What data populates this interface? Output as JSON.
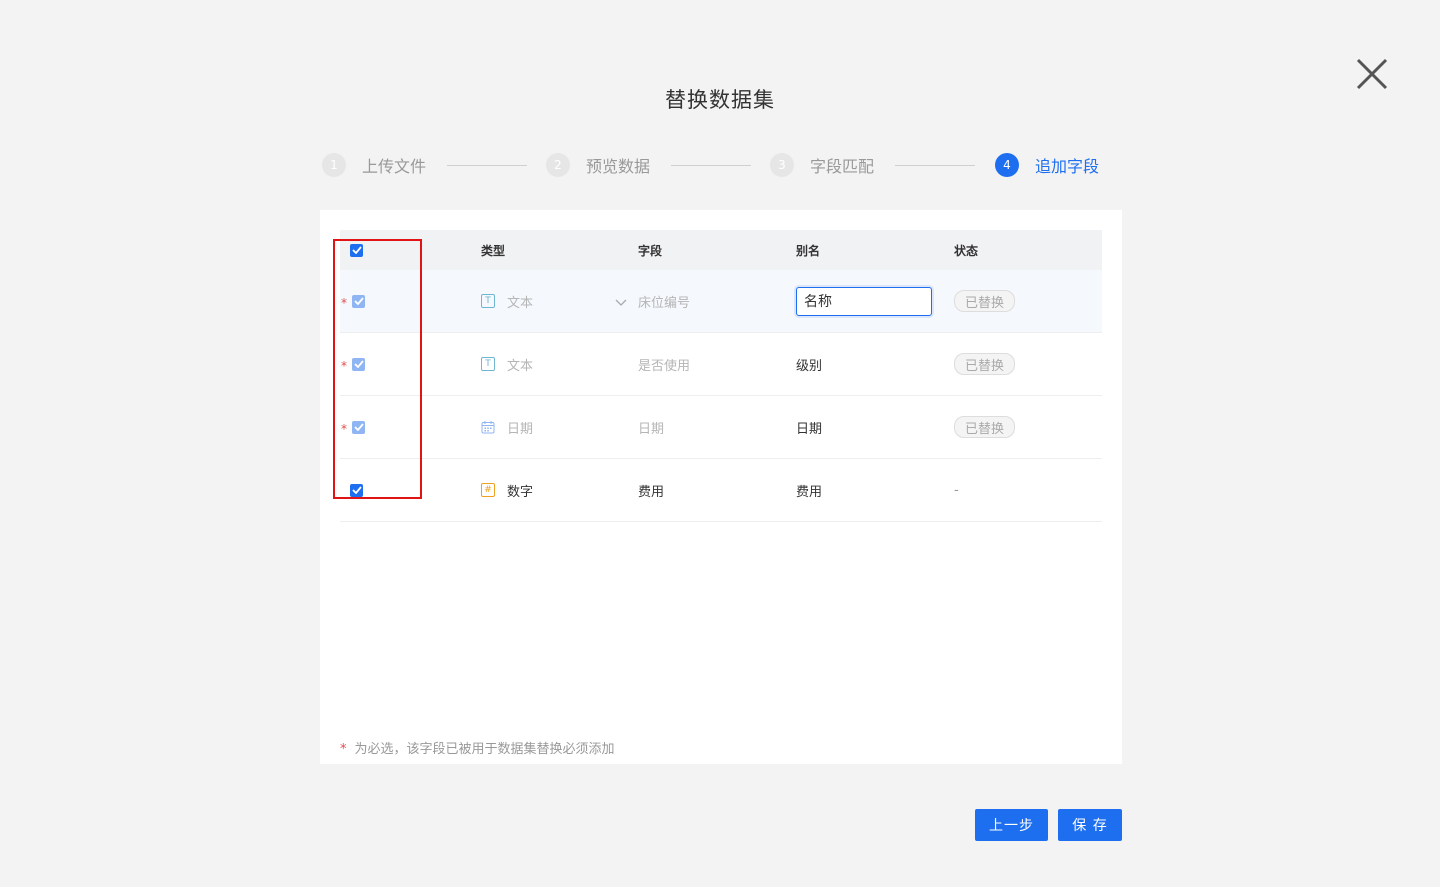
{
  "dialog": {
    "title": "替换数据集",
    "close_icon": "close-icon"
  },
  "steps": [
    {
      "num": "1",
      "label": "上传文件",
      "state": "done"
    },
    {
      "num": "2",
      "label": "预览数据",
      "state": "done"
    },
    {
      "num": "3",
      "label": "字段匹配",
      "state": "done"
    },
    {
      "num": "4",
      "label": "追加字段",
      "state": "active"
    }
  ],
  "table": {
    "headers": {
      "type": "类型",
      "field": "字段",
      "alias": "别名",
      "status": "状态"
    },
    "header_checked": true,
    "rows": [
      {
        "required": "*",
        "checked": true,
        "disabled": true,
        "type_icon": "text-type-icon",
        "type_glyph": "T",
        "type": "文本",
        "field": "床位编号",
        "alias": "名称",
        "alias_editing": true,
        "status": "已替换"
      },
      {
        "required": "*",
        "checked": true,
        "disabled": true,
        "type_icon": "text-type-icon",
        "type_glyph": "T",
        "type": "文本",
        "field": "是否使用",
        "alias": "级别",
        "alias_editing": false,
        "status": "已替换"
      },
      {
        "required": "*",
        "checked": true,
        "disabled": true,
        "type_icon": "calendar-icon",
        "type_glyph": "",
        "type": "日期",
        "field": "日期",
        "alias": "日期",
        "alias_editing": false,
        "status": "已替换"
      },
      {
        "required": "",
        "checked": true,
        "disabled": false,
        "type_icon": "number-type-icon",
        "type_glyph": "#",
        "type": "数字",
        "field": "费用",
        "alias": "费用",
        "alias_editing": false,
        "status": "-"
      }
    ]
  },
  "footnote": {
    "star": "*",
    "text": "为必选，该字段已被用于数据集替换必须添加"
  },
  "buttons": {
    "prev_label": "上一步",
    "save_label": "保 存"
  },
  "colors": {
    "accent": "#1e6ff0",
    "required": "#e24b4b",
    "annotation": "#e01414"
  }
}
